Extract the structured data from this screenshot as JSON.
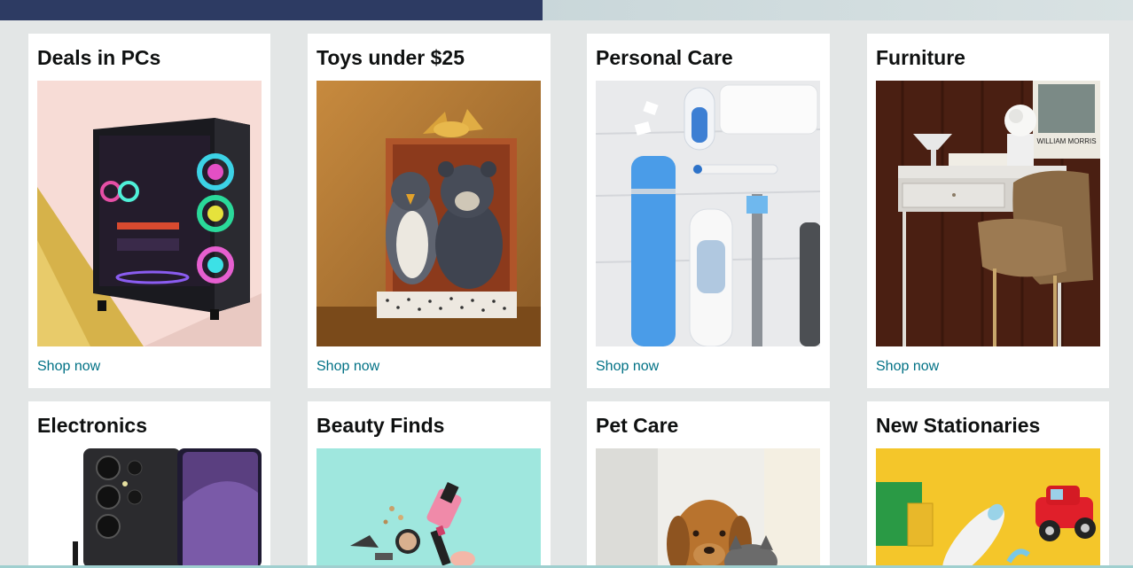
{
  "cards": [
    {
      "title": "Deals in PCs",
      "link": "Shop now"
    },
    {
      "title": "Toys under $25",
      "link": "Shop now"
    },
    {
      "title": "Personal Care",
      "link": "Shop now"
    },
    {
      "title": "Furniture",
      "link": "Shop now"
    },
    {
      "title": "Electronics"
    },
    {
      "title": "Beauty Finds"
    },
    {
      "title": "Pet Care"
    },
    {
      "title": "New Stationaries"
    }
  ],
  "artwork": {
    "poster_text": "WILLIAM MORRIS"
  },
  "colors": {
    "header_navy": "#2d3b63",
    "page_background": "#e3e6e6",
    "card_background": "#ffffff",
    "link": "#007185",
    "title": "#0f1111"
  }
}
